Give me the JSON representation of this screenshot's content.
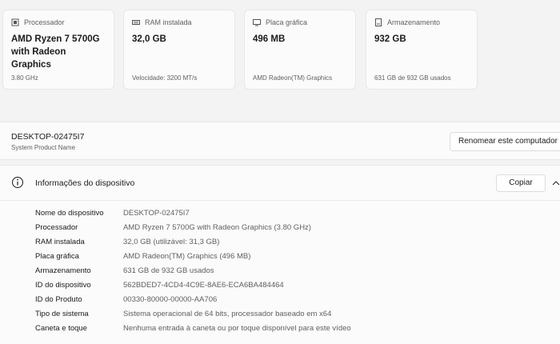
{
  "cards": [
    {
      "icon": "processor-icon",
      "label": "Processador",
      "value": "AMD Ryzen 7 5700G with Radeon Graphics",
      "sub": "3.80 GHz"
    },
    {
      "icon": "ram-icon",
      "label": "RAM instalada",
      "value": "32,0 GB",
      "sub": "Velocidade: 3200 MT/s"
    },
    {
      "icon": "graphics-card-icon",
      "label": "Placa gráfica",
      "value": "496 MB",
      "sub": "AMD Radeon(TM) Graphics"
    },
    {
      "icon": "storage-icon",
      "label": "Armazenamento",
      "value": "932 GB",
      "sub": "631 GB de 932 GB usados"
    }
  ],
  "computer": {
    "name": "DESKTOP-02475I7",
    "model": "System Product Name",
    "rename_label": "Renomear este computador"
  },
  "device_info": {
    "title": "Informações do dispositivo",
    "copy_label": "Copiar",
    "rows": [
      {
        "label": "Nome do dispositivo",
        "value": "DESKTOP-02475I7"
      },
      {
        "label": "Processador",
        "value": "AMD Ryzen 7 5700G with Radeon Graphics (3.80 GHz)"
      },
      {
        "label": "RAM instalada",
        "value": "32,0 GB (utilizável: 31,3 GB)"
      },
      {
        "label": "Placa gráfica",
        "value": "AMD Radeon(TM) Graphics (496 MB)"
      },
      {
        "label": "Armazenamento",
        "value": "631 GB de 932 GB usados"
      },
      {
        "label": "ID do dispositivo",
        "value": "562BDED7-4CD4-4C9E-8AE6-ECA6BA484464"
      },
      {
        "label": "ID do Produto",
        "value": "00330-80000-00000-AA706"
      },
      {
        "label": "Tipo de sistema",
        "value": "Sistema operacional de 64 bits, processador baseado em x64"
      },
      {
        "label": "Caneta e toque",
        "value": "Nenhuma entrada à caneta ou por toque disponível para este vídeo"
      }
    ]
  }
}
